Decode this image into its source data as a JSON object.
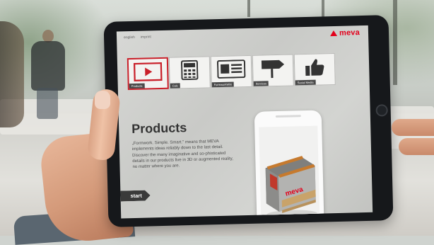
{
  "scene": {
    "description": ""
  },
  "app": {
    "lang": {
      "first": "english",
      "second": "imprint"
    },
    "brand": {
      "name": "meva",
      "color": "#e3001b"
    },
    "tiles": [
      {
        "label": "Products",
        "icon": "play-video-icon",
        "active": true
      },
      {
        "label": "Calc",
        "icon": "calculator-icon",
        "active": false
      },
      {
        "label": "FormworkWiki",
        "icon": "article-icon",
        "active": false
      },
      {
        "label": "Services",
        "icon": "signpost-icon",
        "active": false
      },
      {
        "label": "Social Media",
        "icon": "thumbs-up-icon",
        "active": false
      }
    ],
    "content": {
      "title": "Products",
      "intro": "„Formwork. Simple. Smart.\" means that MEVA implements ideas reliably down to the last detail. Discover the many imaginative and so-phisticated details in our products live in 3D or augmented reality, no matter where you are.",
      "start_label": "start"
    },
    "phone_product": {
      "brand": "meva"
    }
  }
}
